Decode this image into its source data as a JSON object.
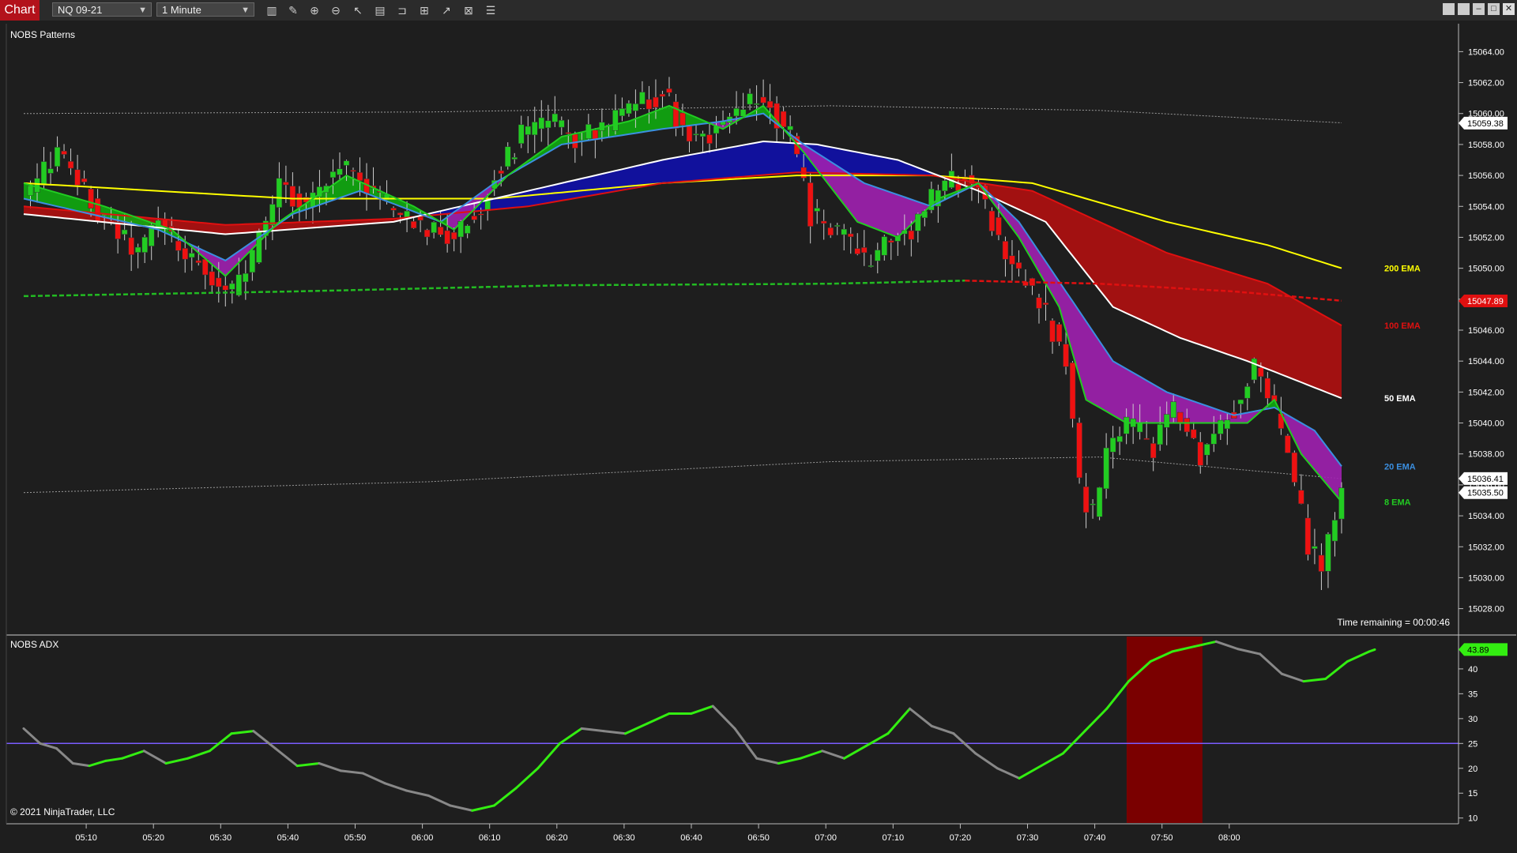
{
  "toolbar": {
    "chart_tab": "Chart",
    "instrument": "NQ 09-21",
    "interval": "1 Minute",
    "tools": [
      "bar-type-icon",
      "draw-icon",
      "zoom-in-icon",
      "zoom-out-icon",
      "pointer-icon",
      "data-box-icon",
      "templates-icon",
      "indicators-icon",
      "strategies-icon",
      "properties-icon",
      "list-icon"
    ],
    "window_buttons": [
      "tile-icon",
      "tile-icon",
      "minimize-icon",
      "maximize-icon",
      "close-icon"
    ]
  },
  "panel_price": {
    "title": "NOBS Patterns",
    "time_remaining": "Time remaining = 00:00:46",
    "ema_labels": [
      {
        "text": "200 EMA",
        "color": "#ffff00",
        "y": 15050.0
      },
      {
        "text": "100 EMA",
        "color": "#e01010",
        "y": 15046.3
      },
      {
        "text": "50 EMA",
        "color": "#ffffff",
        "y": 15041.6
      },
      {
        "text": "20 EMA",
        "color": "#3b8fe0",
        "y": 15037.2
      },
      {
        "text": "8 EMA",
        "color": "#22cc22",
        "y": 15034.9
      }
    ],
    "price_markers": [
      {
        "text": "15059.38",
        "value": 15059.38,
        "bg": "#ffffff",
        "fg": "#000000"
      },
      {
        "text": "15047.89",
        "value": 15047.89,
        "bg": "#e01010",
        "fg": "#ffffff"
      },
      {
        "text": "15036.41",
        "value": 15036.41,
        "bg": "#ffffff",
        "fg": "#000000"
      },
      {
        "text": "15035.50",
        "value": 15035.5,
        "bg": "#ffffff",
        "fg": "#000000"
      }
    ]
  },
  "panel_adx": {
    "title": "NOBS ADX",
    "value_marker": {
      "text": "43.89",
      "value": 43.89
    },
    "copyright": "© 2021 NinjaTrader, LLC"
  },
  "colors": {
    "background": "#1e1e1e",
    "up_candle": "#22cc22",
    "down_candle": "#ee1111",
    "ema200": "#ffff00",
    "ema100": "#e01010",
    "ema50": "#ffffff",
    "ema20": "#3b8fe0",
    "ema8": "#22cc22",
    "band_red": "#b01010",
    "band_blue": "#1010aa",
    "band_green": "#10aa10",
    "band_purple": "#a020b0",
    "vwap": "#22bb22",
    "adx_up": "#33ee11",
    "adx_down": "#888888",
    "adx_level": "#7b5cff",
    "highlight": "#7a0000"
  },
  "chart_data": [
    {
      "type": "candlestick",
      "title": "NOBS Patterns",
      "instrument": "NQ 09-21",
      "interval": "1 Minute",
      "y_ticks": [
        15028,
        15030,
        15032,
        15034,
        15036,
        15038,
        15040,
        15042,
        15044,
        15046,
        15048,
        15050,
        15052,
        15054,
        15056,
        15058,
        15060,
        15062,
        15064
      ],
      "y_tick_labels": [
        "15028.00",
        "15030.00",
        "15032.00",
        "15034.00",
        "15036.00",
        "15038.00",
        "15040.00",
        "15042.00",
        "15044.00",
        "15046.00",
        "15048.00",
        "15050.00",
        "15052.00",
        "15054.00",
        "15056.00",
        "15058.00",
        "15060.00",
        "15062.00",
        "15064.00"
      ],
      "ylim": [
        15026.5,
        15065.5
      ],
      "x_ticks": [
        "05:10",
        "05:20",
        "05:30",
        "05:40",
        "05:50",
        "06:00",
        "06:10",
        "06:20",
        "06:30",
        "06:40",
        "06:50",
        "07:00",
        "07:10",
        "07:20",
        "07:30",
        "07:40",
        "07:50",
        "08:00"
      ],
      "price_path": [
        [
          0,
          15054.5
        ],
        [
          5,
          15057.5
        ],
        [
          8,
          15055.5
        ],
        [
          12,
          15053
        ],
        [
          17,
          15051
        ],
        [
          20,
          15053
        ],
        [
          24,
          15051
        ],
        [
          28,
          15049.5
        ],
        [
          31,
          15048.5
        ],
        [
          34,
          15050.5
        ],
        [
          38,
          15055.5
        ],
        [
          42,
          15054
        ],
        [
          47,
          15057
        ],
        [
          52,
          15055
        ],
        [
          56,
          15053.5
        ],
        [
          60,
          15052.5
        ],
        [
          64,
          15052
        ],
        [
          68,
          15054
        ],
        [
          70,
          15056
        ],
        [
          74,
          15058.5
        ],
        [
          78,
          15059.5
        ],
        [
          82,
          15058.5
        ],
        [
          86,
          15059
        ],
        [
          90,
          15060
        ],
        [
          95,
          15061.5
        ],
        [
          98,
          15059
        ],
        [
          102,
          15058.5
        ],
        [
          106,
          15060
        ],
        [
          110,
          15061
        ],
        [
          114,
          15058.5
        ],
        [
          117,
          15053.5
        ],
        [
          121,
          15052.5
        ],
        [
          125,
          15050.5
        ],
        [
          128,
          15051.5
        ],
        [
          132,
          15052.5
        ],
        [
          136,
          15055
        ],
        [
          140,
          15056
        ],
        [
          142,
          15055
        ],
        [
          145,
          15052
        ],
        [
          148,
          15049.5
        ],
        [
          151,
          15048
        ],
        [
          153,
          15046
        ],
        [
          155,
          15044
        ],
        [
          157,
          15036
        ],
        [
          159,
          15034
        ],
        [
          161,
          15038
        ],
        [
          164,
          15040
        ],
        [
          168,
          15038.5
        ],
        [
          171,
          15041
        ],
        [
          175,
          15038
        ],
        [
          178,
          15040
        ],
        [
          180,
          15041
        ],
        [
          183,
          15043.5
        ],
        [
          186,
          15041
        ],
        [
          188,
          15038
        ],
        [
          191,
          15032
        ],
        [
          193,
          15030.5
        ],
        [
          196,
          15035.5
        ]
      ],
      "ema_paths": {
        "ema200": [
          [
            0,
            15055.5
          ],
          [
            40,
            15054.5
          ],
          [
            70,
            15054.5
          ],
          [
            95,
            15055.5
          ],
          [
            115,
            15056
          ],
          [
            135,
            15056
          ],
          [
            150,
            15055.5
          ],
          [
            170,
            15053
          ],
          [
            185,
            15051.5
          ],
          [
            196,
            15050
          ]
        ],
        "ema100": [
          [
            0,
            15054
          ],
          [
            30,
            15052.8
          ],
          [
            55,
            15053.2
          ],
          [
            75,
            15054
          ],
          [
            95,
            15055.5
          ],
          [
            115,
            15056.2
          ],
          [
            135,
            15056
          ],
          [
            150,
            15055
          ],
          [
            170,
            15051
          ],
          [
            185,
            15049
          ],
          [
            196,
            15046.3
          ]
        ],
        "ema50": [
          [
            0,
            15053.5
          ],
          [
            30,
            15052.2
          ],
          [
            55,
            15053
          ],
          [
            75,
            15055
          ],
          [
            95,
            15057
          ],
          [
            110,
            15058.2
          ],
          [
            118,
            15058
          ],
          [
            130,
            15057
          ],
          [
            142,
            15055
          ],
          [
            152,
            15053
          ],
          [
            162,
            15047.5
          ],
          [
            172,
            15045.5
          ],
          [
            182,
            15044
          ],
          [
            196,
            15041.6
          ]
        ],
        "ema20": [
          [
            0,
            15054.5
          ],
          [
            20,
            15052.5
          ],
          [
            30,
            15050.5
          ],
          [
            40,
            15053.5
          ],
          [
            50,
            15055
          ],
          [
            62,
            15053
          ],
          [
            70,
            15055.5
          ],
          [
            80,
            15058
          ],
          [
            95,
            15059
          ],
          [
            104,
            15059.5
          ],
          [
            110,
            15060
          ],
          [
            116,
            15058
          ],
          [
            125,
            15055.5
          ],
          [
            135,
            15054
          ],
          [
            142,
            15055.5
          ],
          [
            148,
            15053
          ],
          [
            155,
            15048.5
          ],
          [
            162,
            15044
          ],
          [
            170,
            15042
          ],
          [
            180,
            15040.5
          ],
          [
            186,
            15041
          ],
          [
            192,
            15039.5
          ],
          [
            196,
            15037.2
          ]
        ],
        "ema8": [
          [
            0,
            15055.5
          ],
          [
            12,
            15054
          ],
          [
            22,
            15052.5
          ],
          [
            30,
            15049.5
          ],
          [
            38,
            15053
          ],
          [
            48,
            15056
          ],
          [
            58,
            15054
          ],
          [
            64,
            15052.5
          ],
          [
            72,
            15056
          ],
          [
            80,
            15058.5
          ],
          [
            90,
            15059.5
          ],
          [
            96,
            15060.5
          ],
          [
            104,
            15059
          ],
          [
            110,
            15060.5
          ],
          [
            116,
            15057.5
          ],
          [
            124,
            15053
          ],
          [
            130,
            15052
          ],
          [
            136,
            15054.5
          ],
          [
            142,
            15055.5
          ],
          [
            148,
            15052
          ],
          [
            154,
            15047.5
          ],
          [
            158,
            15041.5
          ],
          [
            164,
            15040
          ],
          [
            172,
            15040
          ],
          [
            182,
            15040
          ],
          [
            186,
            15041.5
          ],
          [
            190,
            15038
          ],
          [
            196,
            15034.9
          ]
        ],
        "vwap": [
          [
            0,
            15048.2
          ],
          [
            40,
            15048.5
          ],
          [
            80,
            15048.9
          ],
          [
            120,
            15049
          ],
          [
            140,
            15049.2
          ],
          [
            160,
            15049
          ],
          [
            180,
            15048.5
          ],
          [
            196,
            15047.9
          ]
        ],
        "upper_band": [
          [
            0,
            15060.0
          ],
          [
            60,
            15060.1
          ],
          [
            120,
            15060.5
          ],
          [
            160,
            15060.2
          ],
          [
            196,
            15059.4
          ]
        ],
        "lower_band": [
          [
            0,
            15035.5
          ],
          [
            60,
            15036.2
          ],
          [
            120,
            15037.5
          ],
          [
            160,
            15037.8
          ],
          [
            196,
            15036.4
          ]
        ]
      }
    },
    {
      "type": "line",
      "title": "NOBS ADX",
      "y_ticks": [
        10,
        15,
        20,
        25,
        30,
        35,
        40
      ],
      "y_tick_labels": [
        "10",
        "15",
        "20",
        "25",
        "30",
        "35",
        "40"
      ],
      "ylim": [
        9,
        46.5
      ],
      "level": 25,
      "highlight_range": [
        160,
        171
      ],
      "values": [
        [
          0,
          28
        ],
        [
          3,
          25
        ],
        [
          6,
          24
        ],
        [
          9,
          21
        ],
        [
          12,
          20.5
        ],
        [
          15,
          21.5
        ],
        [
          18,
          22
        ],
        [
          22,
          23.5
        ],
        [
          26,
          21
        ],
        [
          30,
          22
        ],
        [
          34,
          23.5
        ],
        [
          38,
          27
        ],
        [
          42,
          27.5
        ],
        [
          46,
          24
        ],
        [
          50,
          20.5
        ],
        [
          54,
          21
        ],
        [
          58,
          19.5
        ],
        [
          62,
          19
        ],
        [
          66,
          17
        ],
        [
          70,
          15.5
        ],
        [
          74,
          14.5
        ],
        [
          78,
          12.5
        ],
        [
          82,
          11.5
        ],
        [
          86,
          12.5
        ],
        [
          90,
          16
        ],
        [
          94,
          20
        ],
        [
          98,
          25
        ],
        [
          102,
          28
        ],
        [
          106,
          27.5
        ],
        [
          110,
          27
        ],
        [
          114,
          29
        ],
        [
          118,
          31
        ],
        [
          122,
          31
        ],
        [
          126,
          32.5
        ],
        [
          130,
          28
        ],
        [
          134,
          22
        ],
        [
          138,
          21
        ],
        [
          142,
          22
        ],
        [
          146,
          23.5
        ],
        [
          150,
          22
        ],
        [
          154,
          24.5
        ],
        [
          158,
          27
        ],
        [
          162,
          32
        ],
        [
          166,
          28.5
        ],
        [
          170,
          27
        ],
        [
          174,
          23
        ],
        [
          178,
          20
        ],
        [
          182,
          18
        ],
        [
          186,
          20.5
        ],
        [
          190,
          23
        ],
        [
          194,
          27.5
        ],
        [
          198,
          32
        ],
        [
          202,
          37.5
        ],
        [
          206,
          41.5
        ],
        [
          210,
          43.5
        ],
        [
          214,
          44.5
        ],
        [
          218,
          45.5
        ],
        [
          222,
          44
        ],
        [
          226,
          43
        ],
        [
          230,
          39
        ],
        [
          234,
          37.5
        ],
        [
          238,
          38
        ],
        [
          242,
          41.5
        ],
        [
          246,
          43.5
        ],
        [
          247,
          43.89
        ]
      ]
    }
  ]
}
